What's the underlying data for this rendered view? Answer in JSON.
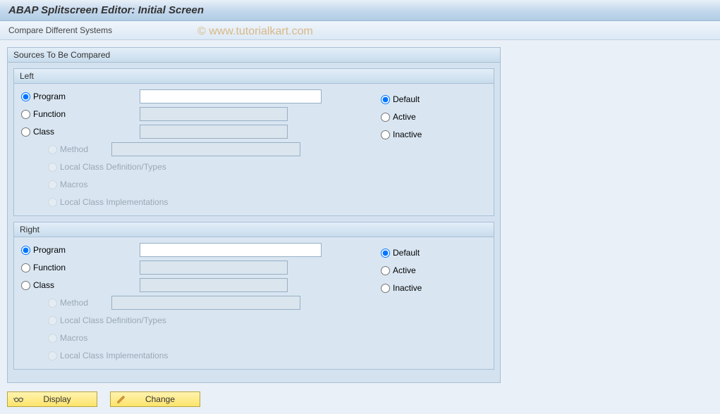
{
  "title": "ABAP Splitscreen Editor: Initial Screen",
  "toolbar": {
    "compare": "Compare Different Systems"
  },
  "watermark": "© www.tutorialkart.com",
  "sources": {
    "title": "Sources To Be Compared",
    "left": {
      "title": "Left",
      "program": "Program",
      "function": "Function",
      "class": "Class",
      "method": "Method",
      "localdef": "Local Class Definition/Types",
      "macros": "Macros",
      "localimpl": "Local Class Implementations",
      "program_val": "",
      "function_val": "",
      "class_val": "",
      "method_val": "",
      "status_default": "Default",
      "status_active": "Active",
      "status_inactive": "Inactive"
    },
    "right": {
      "title": "Right",
      "program": "Program",
      "function": "Function",
      "class": "Class",
      "method": "Method",
      "localdef": "Local Class Definition/Types",
      "macros": "Macros",
      "localimpl": "Local Class Implementations",
      "program_val": "",
      "function_val": "",
      "class_val": "",
      "method_val": "",
      "status_default": "Default",
      "status_active": "Active",
      "status_inactive": "Inactive"
    }
  },
  "buttons": {
    "display": "Display",
    "change": "Change"
  }
}
